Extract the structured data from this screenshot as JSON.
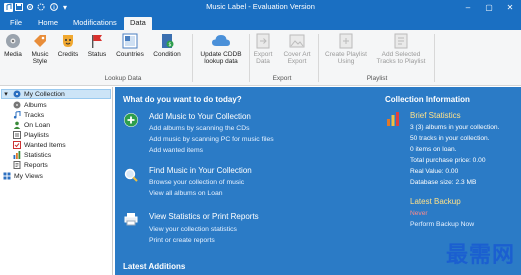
{
  "window": {
    "title": "Music Label - Evaluation Version"
  },
  "ribbon_tabs": [
    "File",
    "Home",
    "Modifications",
    "Data"
  ],
  "ribbon": {
    "lookup_buttons": [
      "Media",
      "Music Style",
      "Credits",
      "Status",
      "Countries",
      "Condition"
    ],
    "cddb_button": "Update CDDB lookup data",
    "lookup_group": "Lookup Data",
    "export_buttons": [
      "Export Data",
      "Cover Art Export"
    ],
    "export_group": "Export",
    "playlist_buttons": [
      "Create Playlist Using",
      "Add Selected Tracks to Playlist"
    ],
    "playlist_group": "Playlist"
  },
  "sidebar": {
    "root": "My Collection",
    "items": [
      "Albums",
      "Tracks",
      "On Loan",
      "Playlists",
      "Wanted Items",
      "Statistics",
      "Reports"
    ],
    "views": "My Views"
  },
  "main": {
    "heading": "What do you want to do today?",
    "sections": [
      {
        "title": "Add Music to Your Collection",
        "links": [
          "Add albums by scanning the CDs",
          "Add music by scanning PC for music files",
          "Add wanted items"
        ]
      },
      {
        "title": "Find Music in Your Collection",
        "links": [
          "Browse your collection of music",
          "View all albums on Loan"
        ]
      },
      {
        "title": "View Statistics or Print Reports",
        "links": [
          "View your collection statistics",
          "Print or create reports"
        ]
      }
    ],
    "latest_additions": "Latest Additions"
  },
  "info": {
    "heading": "Collection Information",
    "brief_title": "Brief Statistics",
    "stats": [
      "3 (3) albums in your collection.",
      "50 tracks in your collection.",
      "0 items on loan.",
      "Total purchase price: 0.00",
      "Real Value: 0.00",
      "Database size: 2.3 MB"
    ],
    "backup_title": "Latest Backup",
    "backup_status": "Never",
    "backup_link": "Perform Backup Now"
  },
  "watermark": "最需网",
  "colors": {
    "accent": "#1a6fc2",
    "content_bg": "#2b7bc6"
  }
}
